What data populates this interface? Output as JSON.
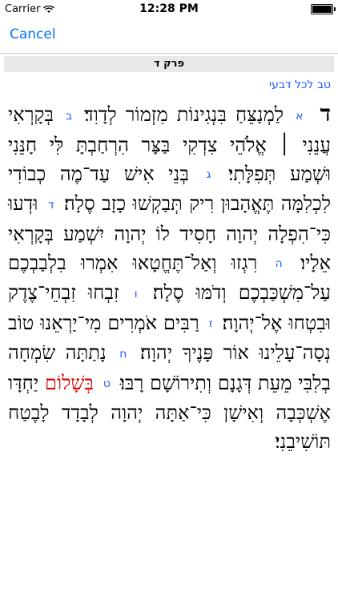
{
  "status": {
    "carrier": "Carrier",
    "time": "12:28 PM"
  },
  "nav": {
    "cancel": "Cancel"
  },
  "chapter": {
    "header": "פרק ד",
    "subtitle": "טב לכל דבעי",
    "chapter_letter": "ד"
  },
  "verses": [
    {
      "num": "א",
      "text": "לַמְנַצֵּחַ בִּנְגִינוֹת מִזְמוֹר לְדָוִד׃"
    },
    {
      "num": "ב",
      "text": "בְּקָרְאִי עֲנֵנִי ׀ אֱלֹהֵי צִדְקִי בַּצָּר הִרְחַבְתָּ לִּי חָנֵּנִי וּשְׁמַע תְּפִלָּתִי׃"
    },
    {
      "num": "ג",
      "text": "בְּנֵי אִישׁ עַד־מֶה כְבוֹדִי לִכְלִמָּה תֶּאֱהָבוּן רִיק תְּבַקְשׁוּ כָזָב סֶלָה׃"
    },
    {
      "num": "ד",
      "text": "וּדְעוּ כִּי־הִפְלָה יְהוָה חָסִיד לוֹ יְהוָה יִשְׁמַע בְּקָרְאִי אֵלָיו׃"
    },
    {
      "num": "ה",
      "text": "רִגְזוּ וְאַל־תֶּחֱטָאוּ אִמְרוּ בִלְבַבְכֶם עַל־מִשְׁכַּבְכֶם וְדֹמּוּ סֶלָה׃"
    },
    {
      "num": "ו",
      "text": "זִבְחוּ זִבְחֵי־צֶדֶק וּבִטְחוּ אֶל־יְהוָה׃"
    },
    {
      "num": "ז",
      "text": "רַבִּים אֹמְרִים מִי־יַרְאֵנוּ טוֹב נְסָה־עָלֵינוּ אוֹר פָּנֶיךָ יְהוָה׃"
    },
    {
      "num": "ח",
      "text": "נָתַתָּה שִׂמְחָה בְלִבִּי מֵעֵת דְּגָנָם וְתִירוֹשָׁם רָבּוּ׃"
    },
    {
      "num": "ט",
      "text_red": "בְּשָׁלוֹם",
      "text": "יַחְדָּו אֶשְׁכְּבָה וְאִישָׁן כִּי־אַתָּה יְהוָה לְבָדָד לָבֶטַח תּוֹשִׁיבֵנִי׃"
    }
  ],
  "colors": {
    "accent": "#0a72ff",
    "verse_number": "#1a5aff",
    "highlight": "#d90000"
  }
}
